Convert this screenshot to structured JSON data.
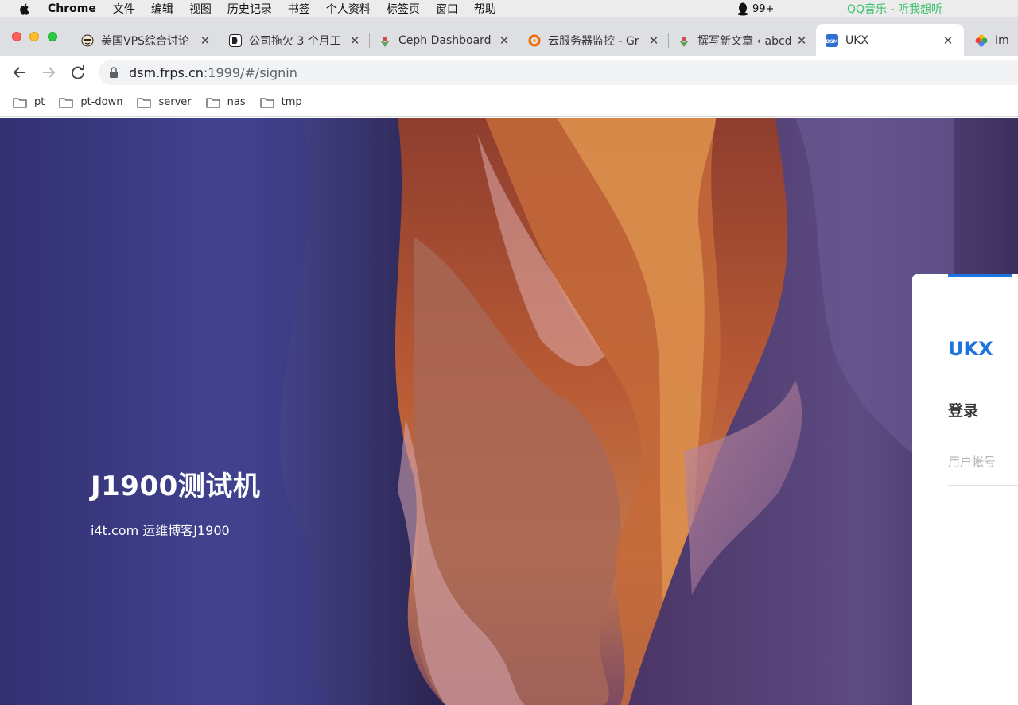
{
  "menubar": {
    "app_name": "Chrome",
    "menus": [
      "文件",
      "编辑",
      "视图",
      "历史记录",
      "书签",
      "个人资料",
      "标签页",
      "窗口",
      "帮助"
    ],
    "qq_badge": "99+",
    "music_status": "QQ音乐 - 听我想听"
  },
  "tabs": [
    {
      "title": "美国VPS综合讨论",
      "icon": "forum-icon"
    },
    {
      "title": "公司拖欠 3 个月工",
      "icon": "v2ex-icon"
    },
    {
      "title": "Ceph Dashboard Pr",
      "icon": "ceph-icon"
    },
    {
      "title": "云服务器监控 - Gr",
      "icon": "grafana-icon"
    },
    {
      "title": "撰写新文章 ‹ abcd",
      "icon": "wordpress-icon"
    },
    {
      "title": "UKX",
      "icon": "dsm-icon"
    },
    {
      "title": "ImgK",
      "icon": "photos-icon"
    }
  ],
  "address": {
    "host": "dsm.frps.cn",
    "rest": ":1999/#/signin"
  },
  "bookmarks": [
    "pt",
    "pt-down",
    "server",
    "nas",
    "tmp"
  ],
  "hero": {
    "title": "J1900测试机",
    "subtitle": "i4t.com 运维博客J1900"
  },
  "login": {
    "brand": "UKX",
    "heading": "登录",
    "account_placeholder": "用户帐号",
    "accent": "#1f74e0"
  }
}
